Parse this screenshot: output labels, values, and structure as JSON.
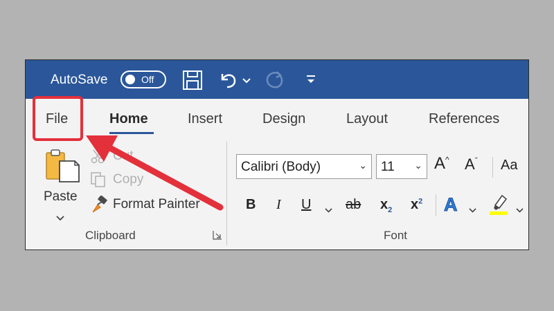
{
  "titlebar": {
    "autosave_label": "AutoSave",
    "autosave_state": "Off",
    "icons": [
      "save-icon",
      "undo-icon",
      "undo-dropdown-icon",
      "redo-icon",
      "customize-toolbar-icon"
    ]
  },
  "tabs": [
    {
      "label": "File"
    },
    {
      "label": "Home",
      "active": true
    },
    {
      "label": "Insert"
    },
    {
      "label": "Design"
    },
    {
      "label": "Layout"
    },
    {
      "label": "References"
    }
  ],
  "clipboard": {
    "paste_label": "Paste",
    "cut_label": "Cut",
    "copy_label": "Copy",
    "format_painter_label": "Format Painter",
    "group_label": "Clipboard"
  },
  "font": {
    "font_name": "Calibri (Body)",
    "font_size": "11",
    "change_case_label": "Aa",
    "bold": "B",
    "italic": "I",
    "underline": "U",
    "strikethrough": "ab",
    "subscript": "x",
    "subscript_mark": "2",
    "superscript": "x",
    "superscript_mark": "2",
    "text_effects": "A",
    "grow_font": "A",
    "shrink_font": "A",
    "group_label": "Font"
  },
  "colors": {
    "titlebar": "#2b579a",
    "highlight_box": "#e3303b",
    "arrow": "#e3303b",
    "ribbon_bg": "#f3f3f3",
    "background": "#b3b3b3",
    "highlighter_yellow": "#ffff00"
  },
  "annotation": {
    "type": "arrow pointing to File tab with red highlight box"
  }
}
